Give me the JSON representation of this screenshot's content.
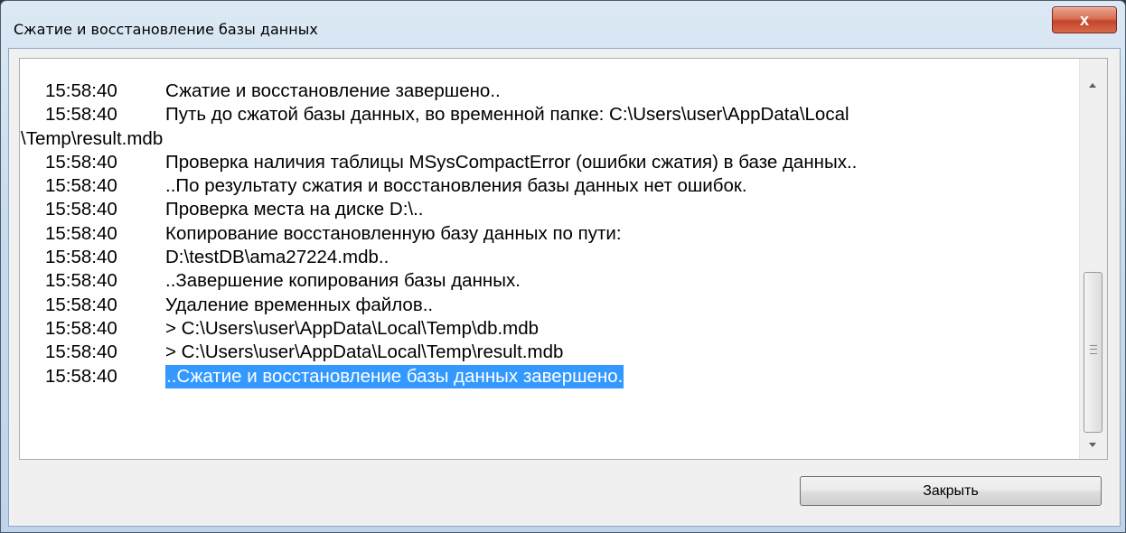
{
  "window": {
    "title": "Сжатие и восстановление базы данных",
    "close_glyph": "x"
  },
  "log": {
    "entries": [
      {
        "time": "15:58:40",
        "message": "Сжатие и восстановление завершено.."
      },
      {
        "time": "15:58:40",
        "message": "Путь до сжатой базы данных, во временной папке: C:\\Users\\user\\AppData\\Local"
      },
      {
        "time": "",
        "message": "\\Temp\\result.mdb"
      },
      {
        "time": "15:58:40",
        "message": "Проверка наличия таблицы MSysCompactError (ошибки сжатия) в базе данных.."
      },
      {
        "time": "15:58:40",
        "message": "..По результату сжатия и восстановления базы данных нет ошибок."
      },
      {
        "time": "15:58:40",
        "message": "Проверка места на диске D:\\.."
      },
      {
        "time": "15:58:40",
        "message": "Копирование восстановленную базу данных по пути:"
      },
      {
        "time": "15:58:40",
        "message": "D:\\testDB\\ama27224.mdb.."
      },
      {
        "time": "15:58:40",
        "message": "..Завершение копирования базы данных."
      },
      {
        "time": "15:58:40",
        "message": "Удаление временных файлов.."
      },
      {
        "time": "15:58:40",
        "message": "> C:\\Users\\user\\AppData\\Local\\Temp\\db.mdb"
      },
      {
        "time": "15:58:40",
        "message": "> C:\\Users\\user\\AppData\\Local\\Temp\\result.mdb"
      },
      {
        "time": "15:58:40",
        "message": "..Сжатие и восстановление базы данных завершено."
      }
    ],
    "selected_index": 12
  },
  "buttons": {
    "close_label": "Закрыть"
  },
  "colors": {
    "selection": "#3399ff",
    "close_button_red": "#c3442a"
  }
}
